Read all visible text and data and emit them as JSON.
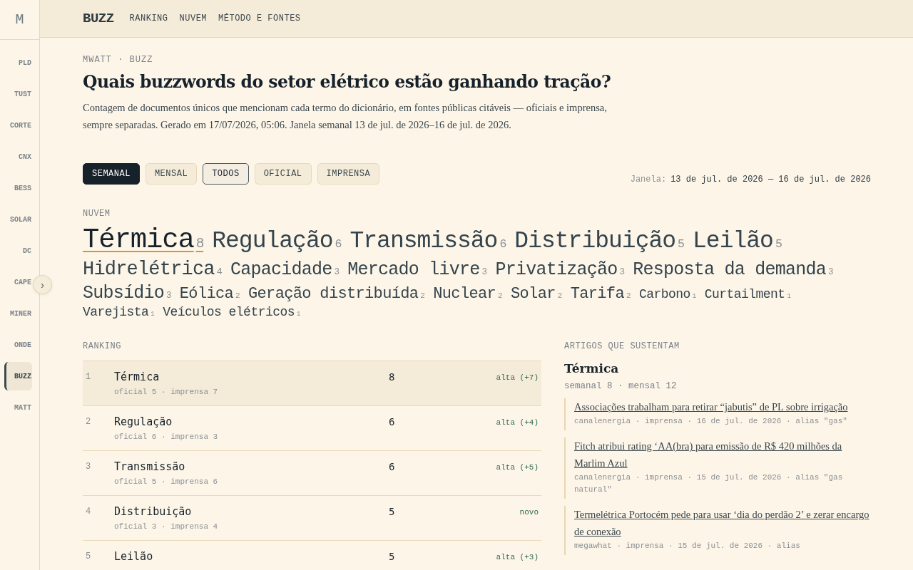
{
  "sidebar": {
    "logo": "M",
    "items": [
      {
        "label": "PLD",
        "selected": false
      },
      {
        "label": "TUST",
        "selected": false
      },
      {
        "label": "CORTE",
        "selected": false
      },
      {
        "label": "CNX",
        "selected": false
      },
      {
        "label": "BESS",
        "selected": false
      },
      {
        "label": "SOLAR",
        "selected": false
      },
      {
        "label": "DC",
        "selected": false
      },
      {
        "label": "CAPE",
        "selected": false
      },
      {
        "label": "MINER",
        "selected": false
      },
      {
        "label": "ONDE",
        "selected": false
      },
      {
        "label": "BUZZ",
        "selected": true
      },
      {
        "label": "MATT",
        "selected": false
      }
    ],
    "toggle": "›"
  },
  "header": {
    "brand": "BUZZ",
    "nav": [
      "RANKING",
      "NUVEM",
      "MÉTODO E FONTES"
    ]
  },
  "breadcrumb": "MWATT · BUZZ",
  "title": "Quais buzzwords do setor elétrico estão ganhando tração?",
  "description": "Contagem de documentos únicos que mencionam cada termo do dicionário, em fontes públicas citáveis — oficiais e imprensa, sempre separadas. Gerado em 17/07/2026, 05:06. Janela semanal 13 de jul. de 2026–16 de jul. de 2026.",
  "filters": [
    {
      "label": "SEMANAL",
      "kind": "period",
      "selected": true
    },
    {
      "label": "MENSAL",
      "kind": "period",
      "selected": false
    },
    {
      "label": "TODOS",
      "kind": "source",
      "selected": true
    },
    {
      "label": "OFICIAL",
      "kind": "source",
      "selected": false
    },
    {
      "label": "IMPRENSA",
      "kind": "source",
      "selected": false
    }
  ],
  "window": {
    "label": "Janela:",
    "value": "13 de jul. de 2026 — 16 de jul. de 2026"
  },
  "cloud": {
    "heading": "NUVEM",
    "terms": [
      {
        "term": "Térmica",
        "count": "8",
        "selected": true
      },
      {
        "term": "Regulação",
        "count": "6",
        "selected": false
      },
      {
        "term": "Transmissão",
        "count": "6",
        "selected": false
      },
      {
        "term": "Distribuição",
        "count": "5",
        "selected": false
      },
      {
        "term": "Leilão",
        "count": "5",
        "selected": false
      },
      {
        "term": "Hidrelétrica",
        "count": "4",
        "selected": false
      },
      {
        "term": "Capacidade",
        "count": "3",
        "selected": false
      },
      {
        "term": "Mercado livre",
        "count": "3",
        "selected": false
      },
      {
        "term": "Privatização",
        "count": "3",
        "selected": false
      },
      {
        "term": "Resposta da demanda",
        "count": "3",
        "selected": false
      },
      {
        "term": "Subsídio",
        "count": "3",
        "selected": false
      },
      {
        "term": "Eólica",
        "count": "2",
        "selected": false
      },
      {
        "term": "Geração distribuída",
        "count": "2",
        "selected": false
      },
      {
        "term": "Nuclear",
        "count": "2",
        "selected": false
      },
      {
        "term": "Solar",
        "count": "2",
        "selected": false
      },
      {
        "term": "Tarifa",
        "count": "2",
        "selected": false
      },
      {
        "term": "Carbono",
        "count": "1",
        "selected": false
      },
      {
        "term": "Curtailment",
        "count": "1",
        "selected": false
      },
      {
        "term": "Varejista",
        "count": "1",
        "selected": false
      },
      {
        "term": "Veículos elétricos",
        "count": "1",
        "selected": false
      }
    ]
  },
  "ranking": {
    "heading": "RANKING",
    "rows": [
      {
        "rank": "1",
        "term": "Térmica",
        "sources": "oficial 5 · imprensa 7",
        "count": "8",
        "trend": "alta (+7)",
        "selected": true
      },
      {
        "rank": "2",
        "term": "Regulação",
        "sources": "oficial 6 · imprensa 3",
        "count": "6",
        "trend": "alta (+4)",
        "selected": false
      },
      {
        "rank": "3",
        "term": "Transmissão",
        "sources": "oficial 5 · imprensa 6",
        "count": "6",
        "trend": "alta (+5)",
        "selected": false
      },
      {
        "rank": "4",
        "term": "Distribuição",
        "sources": "oficial 3 · imprensa 4",
        "count": "5",
        "trend": "novo",
        "selected": false
      },
      {
        "rank": "5",
        "term": "Leilão",
        "sources": "",
        "count": "5",
        "trend": "alta (+3)",
        "selected": false
      }
    ]
  },
  "articles": {
    "heading": "ARTIGOS QUE SUSTENTAM",
    "term": "Térmica",
    "counts": "semanal 8 · mensal 12",
    "items": [
      {
        "title": "Associações trabalham para retirar “jabutis” de PL sobre irrigação",
        "meta": "canalenergia · imprensa · 16 de jul. de 2026 · alias \"gas\""
      },
      {
        "title": "Fitch atribui rating ‘AA(bra) para emissão de R$ 420 milhões da Marlim Azul",
        "meta": "canalenergia · imprensa · 15 de jul. de 2026 · alias \"gas natural\""
      },
      {
        "title": "Termelétrica Portocém pede para usar ‘dia do perdão 2’ e zerar encargo de conexão",
        "meta": "megawhat · imprensa · 15 de jul. de 2026 · alias"
      }
    ]
  }
}
